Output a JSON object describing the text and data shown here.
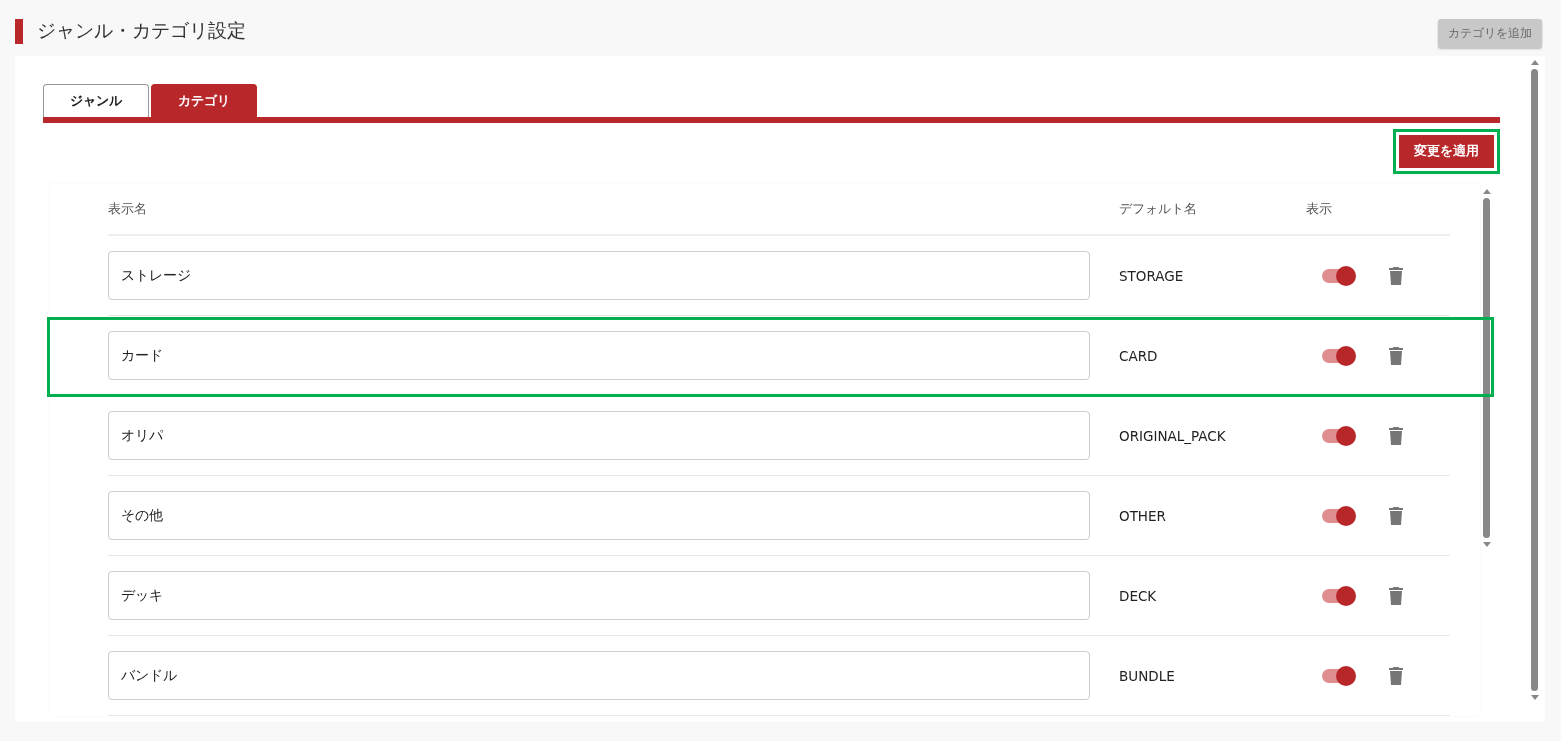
{
  "page": {
    "title": "ジャンル・カテゴリ設定",
    "add_button": "カテゴリを追加"
  },
  "tabs": [
    {
      "label": "ジャンル",
      "selected": false
    },
    {
      "label": "カテゴリ",
      "selected": true
    }
  ],
  "apply_button": {
    "label": "変更を適用",
    "highlighted": true
  },
  "table": {
    "columns": [
      "表示名",
      "デフォルト名",
      "表示"
    ],
    "rows": [
      {
        "display_name": "ストレージ",
        "default_name": "STORAGE",
        "visible": true,
        "highlighted": false
      },
      {
        "display_name": "カード",
        "default_name": "CARD",
        "visible": true,
        "highlighted": true
      },
      {
        "display_name": "オリパ",
        "default_name": "ORIGINAL_PACK",
        "visible": true,
        "highlighted": false
      },
      {
        "display_name": "その他",
        "default_name": "OTHER",
        "visible": true,
        "highlighted": false
      },
      {
        "display_name": "デッキ",
        "default_name": "DECK",
        "visible": true,
        "highlighted": false
      },
      {
        "display_name": "バンドル",
        "default_name": "BUNDLE",
        "visible": true,
        "highlighted": false
      }
    ]
  }
}
